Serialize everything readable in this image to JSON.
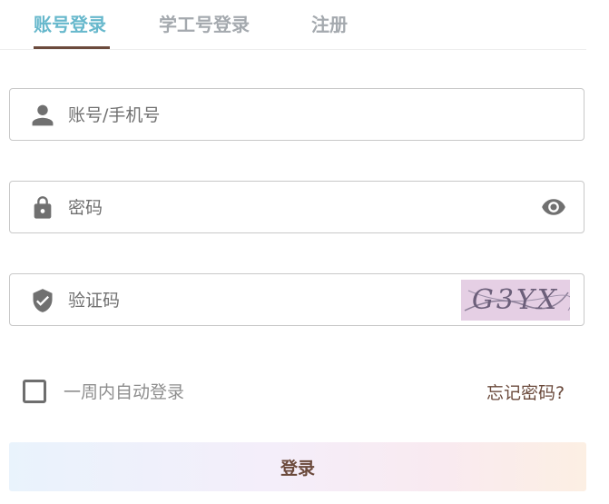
{
  "tabs": [
    {
      "label": "账号登录",
      "active": true
    },
    {
      "label": "学工号登录",
      "active": false
    },
    {
      "label": "注册",
      "active": false
    }
  ],
  "account": {
    "placeholder": "账号/手机号",
    "icon": "user-icon"
  },
  "password": {
    "placeholder": "密码",
    "icon": "lock-icon",
    "toggle_icon": "eye-icon"
  },
  "captcha": {
    "placeholder": "验证码",
    "icon": "shield-check-icon",
    "code": "G3YX"
  },
  "remember": {
    "label": "一周内自动登录",
    "checked": false
  },
  "forgot_label": "忘记密码?",
  "login_label": "登录",
  "colors": {
    "accent": "#67b8cc",
    "brand": "#6b4a3c",
    "inactive_tab": "#a4a9ae"
  }
}
